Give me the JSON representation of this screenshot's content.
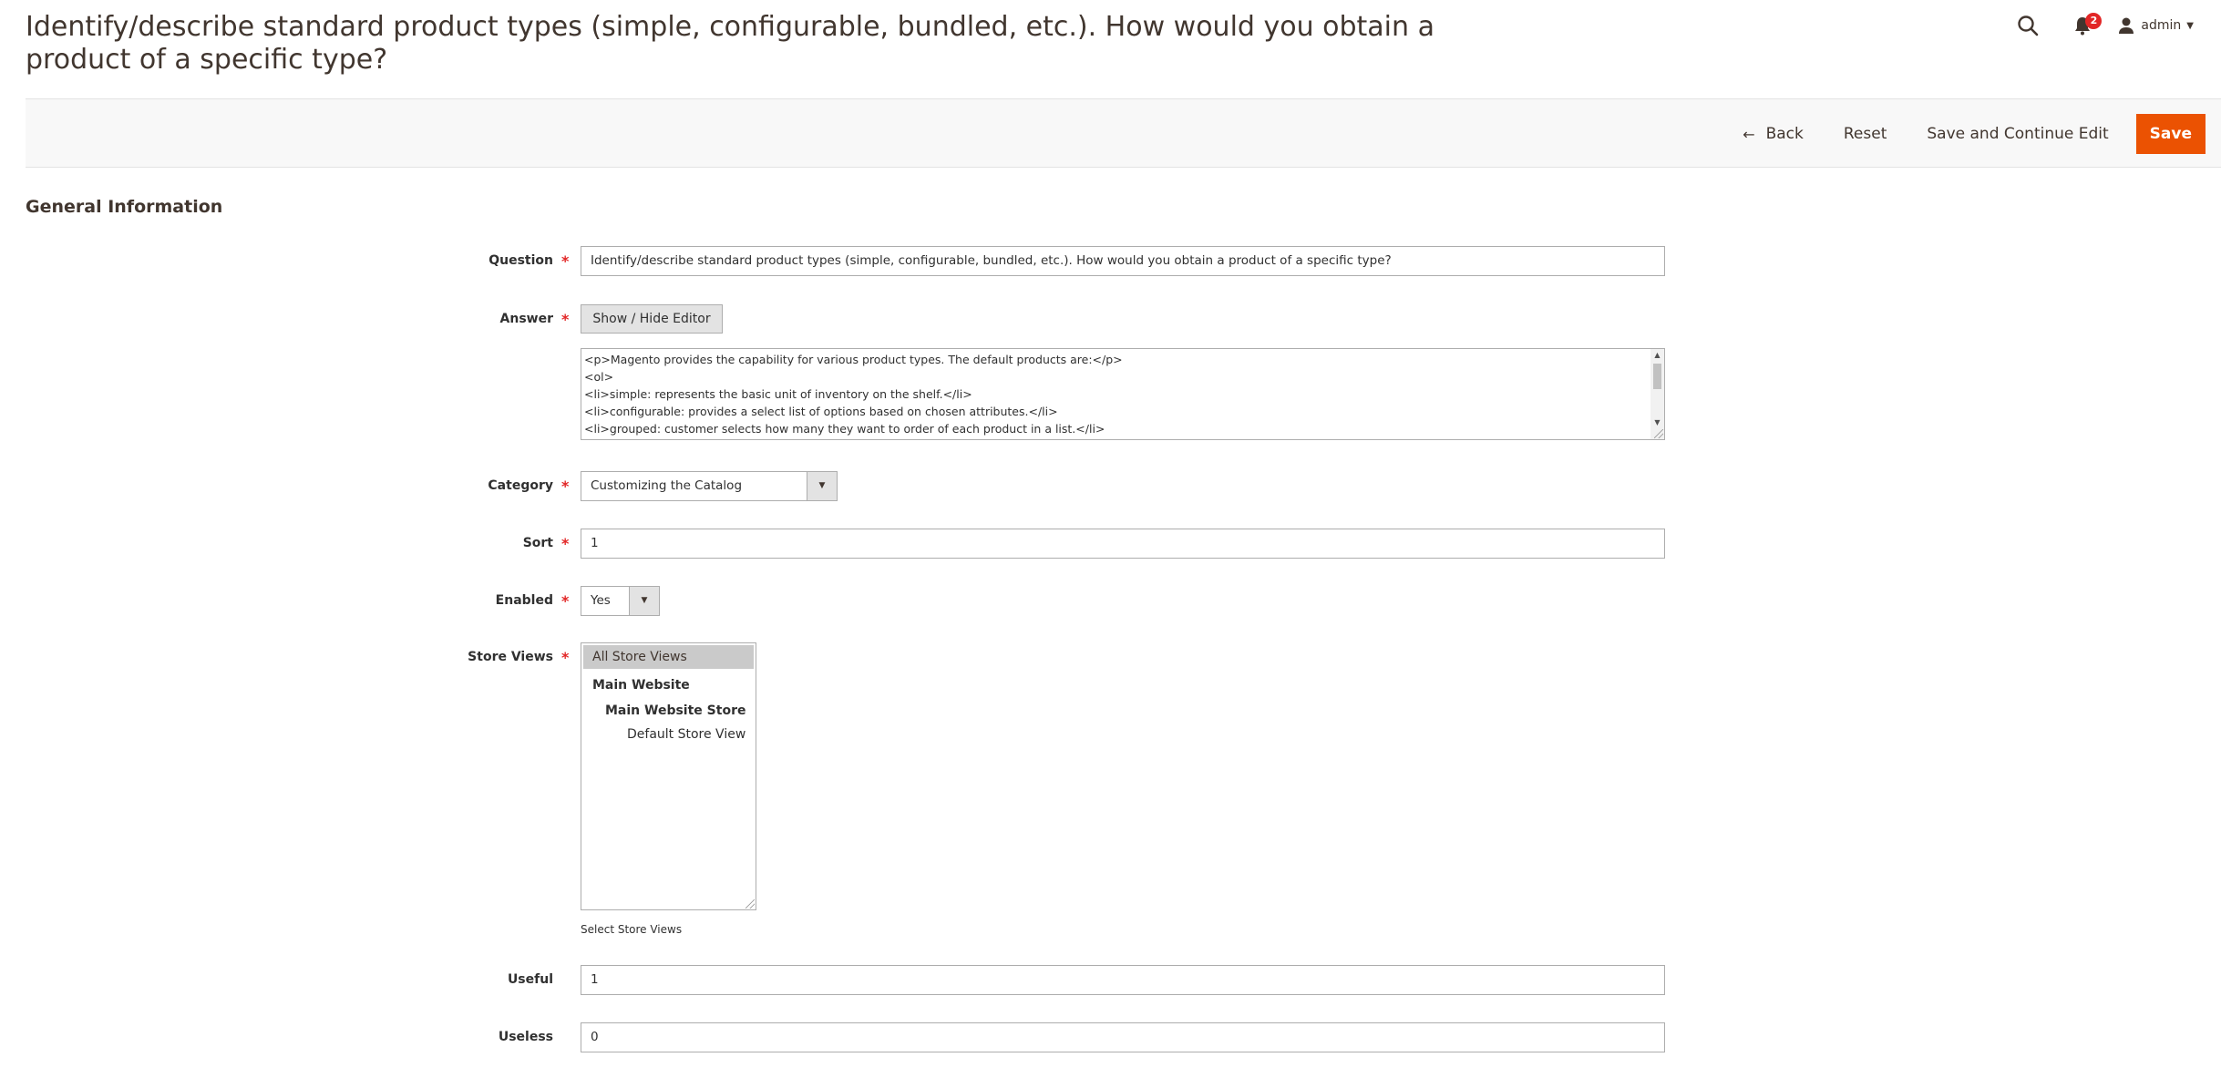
{
  "header": {
    "title": "Identify/describe standard product types (simple, configurable, bundled, etc.). How would you obtain a product of a specific type?",
    "notifications_count": "2",
    "user_name": "admin"
  },
  "actions": {
    "back": "Back",
    "reset": "Reset",
    "save_continue": "Save and Continue Edit",
    "save": "Save"
  },
  "section": {
    "title": "General Information"
  },
  "form": {
    "question": {
      "label": "Question",
      "value": "Identify/describe standard product types (simple, configurable, bundled, etc.). How would you obtain a product of a specific type?"
    },
    "answer": {
      "label": "Answer",
      "toggle_label": "Show / Hide Editor",
      "lines": [
        "<p>Magento provides the capability for various product types. The default products are:</p>",
        "<ol>",
        "<li>simple: represents the basic unit of inventory on the shelf.</li>",
        "<li>configurable: provides a select list of options based on chosen attributes.</li>",
        "<li>grouped: customer selects how many they want to order of each product in a list.</li>"
      ]
    },
    "category": {
      "label": "Category",
      "value": "Customizing the Catalog"
    },
    "sort": {
      "label": "Sort",
      "value": "1"
    },
    "enabled": {
      "label": "Enabled",
      "value": "Yes"
    },
    "store_views": {
      "label": "Store Views",
      "options": [
        "All Store Views",
        "Main Website",
        "Main Website Store",
        "Default Store View"
      ],
      "selected": "All Store Views",
      "note": "Select Store Views"
    },
    "useful": {
      "label": "Useful",
      "value": "1"
    },
    "useless": {
      "label": "Useless",
      "value": "0"
    }
  },
  "colors": {
    "primary_button": "#eb5202",
    "required_marker": "#e22626",
    "notification_badge": "#e22626"
  },
  "icons": {
    "search": "search-icon",
    "notifications": "bell-icon",
    "user": "user-icon",
    "back": "arrow-left-icon"
  }
}
